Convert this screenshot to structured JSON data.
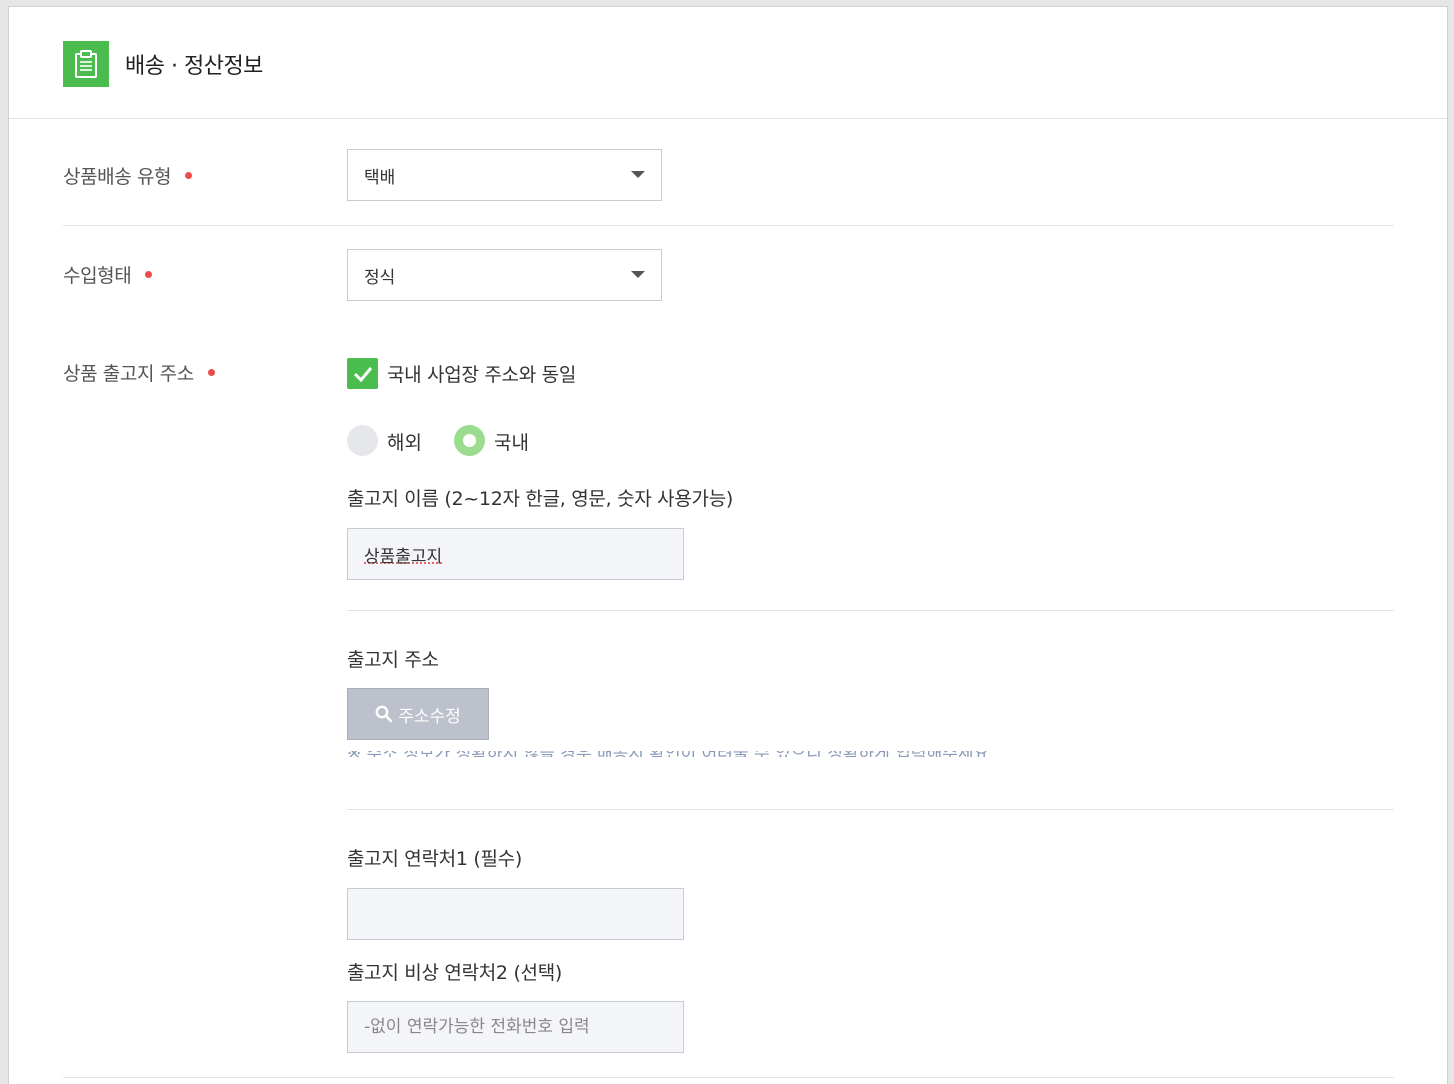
{
  "header": {
    "title": "배송 · 정산정보",
    "icon": "clipboard-icon",
    "icon_color": "#4bbd4f"
  },
  "delivery_type": {
    "label": "상품배송 유형",
    "value": "택배"
  },
  "import_type": {
    "label": "수입형태",
    "value": "정식"
  },
  "shipping_address": {
    "label": "상품 출고지 주소",
    "same_as_business_checkbox": {
      "label": "국내 사업장 주소와 동일",
      "checked": true
    },
    "region_radio": {
      "options": [
        "해외",
        "국내"
      ],
      "selected": "국내"
    },
    "name_field": {
      "label": "출고지 이름 (2~12자 한글, 영문, 숫자 사용가능)",
      "value": "상품출고지"
    },
    "address": {
      "label": "출고지 주소",
      "edit_button": "주소수정",
      "hint": "※ 주소 정보가 정확하지 않을 경우 배송지 확인이 어려울 수 있으니 정확하게 입력해주세요"
    },
    "contact1": {
      "label": "출고지 연락처1 (필수)",
      "value": ""
    },
    "contact2": {
      "label": "출고지 비상 연락처2 (선택)",
      "placeholder": "-없이 연락가능한 전화번호 입력"
    }
  },
  "colors": {
    "accent": "#4bbd4f",
    "required_dot": "#ee4b4b",
    "radio_selected": "#9bdc8e",
    "button_bg": "#bcc1cb"
  }
}
